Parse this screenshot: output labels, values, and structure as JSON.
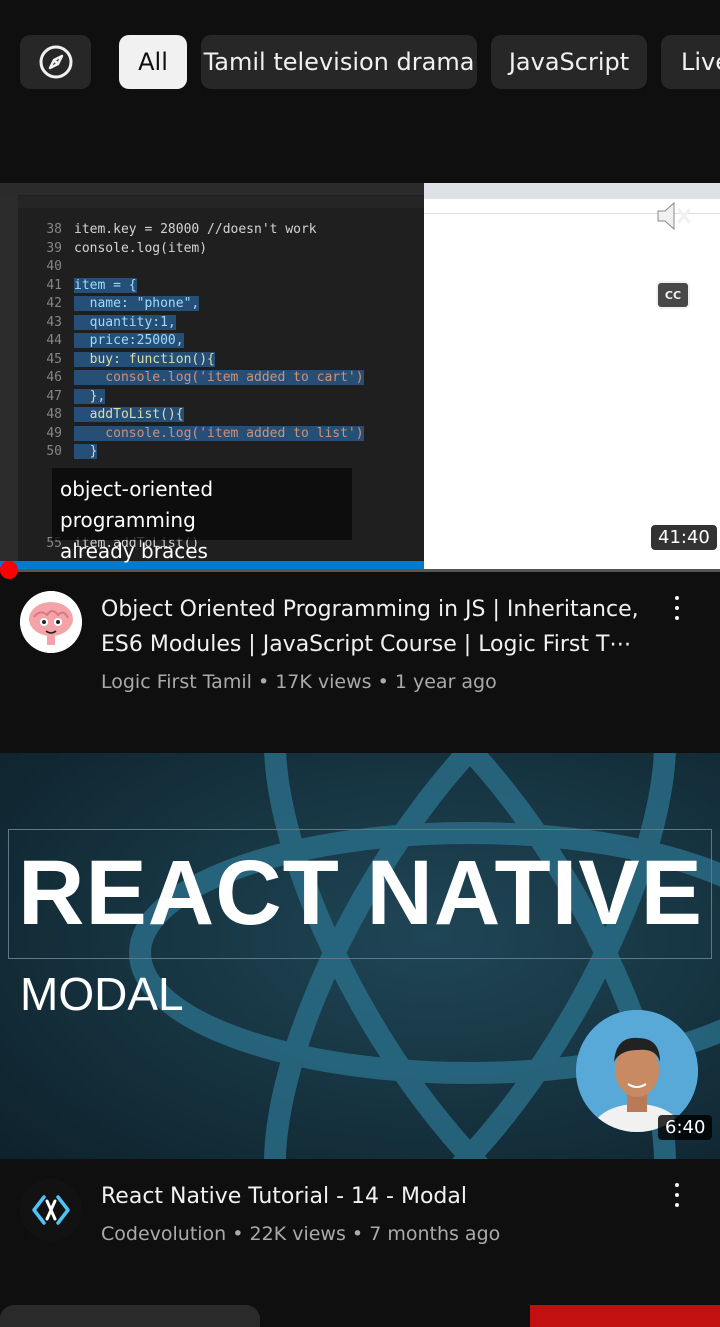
{
  "chips": {
    "explore_icon": "compass-icon",
    "items": [
      "All",
      "Tamil television drama",
      "JavaScript",
      "Live"
    ]
  },
  "video1": {
    "thumbnail": {
      "editor": {
        "lines": [
          {
            "n": "38",
            "text": "item.key = 28000 //doesn't work"
          },
          {
            "n": "39",
            "text": "console.log(item)"
          },
          {
            "n": "40",
            "text": ""
          },
          {
            "n": "41",
            "text": "item = {"
          },
          {
            "n": "42",
            "text": "  name: \"phone\","
          },
          {
            "n": "43",
            "text": "  quantity:1,"
          },
          {
            "n": "44",
            "text": "  price:25000,"
          },
          {
            "n": "45",
            "text": "  buy: function(){"
          },
          {
            "n": "46",
            "text": "    console.log('item added to cart')"
          },
          {
            "n": "47",
            "text": "  },"
          },
          {
            "n": "48",
            "text": "  addToList(){"
          },
          {
            "n": "49",
            "text": "    console.log('item added to list')"
          },
          {
            "n": "50",
            "text": "  }"
          },
          {
            "n": "55",
            "text": "item.addToList()"
          }
        ]
      },
      "caption_lines": [
        "object-oriented programming",
        "already braces"
      ],
      "cc_label": "CC",
      "mute_icon": "muted-speaker-icon",
      "duration": "41:40"
    },
    "title": "Object Oriented Programming in JS | Inheritance, ES6 Modules | JavaScript Course | Logic First T⋯",
    "channel": "Logic First Tamil",
    "views": "17K views",
    "age": "1 year ago",
    "separator": "•"
  },
  "video2": {
    "thumbnail": {
      "headline": "REACT NATIVE",
      "subheadline": "MODAL",
      "duration": "6:40"
    },
    "title": "React Native Tutorial - 14 - Modal",
    "channel": "Codevolution",
    "views": "22K views",
    "age": "7 months ago",
    "separator": "•"
  },
  "colors": {
    "background": "#0f0f0f",
    "chip": "#272727",
    "chip_active": "#f1f1f1",
    "progress_red": "#ff0000",
    "meta_text": "#aaaaaa"
  }
}
